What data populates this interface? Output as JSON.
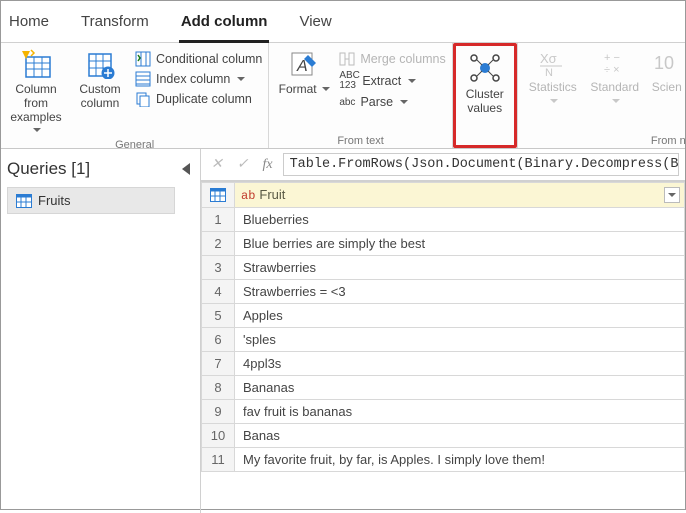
{
  "tabs": {
    "home": "Home",
    "transform": "Transform",
    "add_column": "Add column",
    "view": "View"
  },
  "ribbon": {
    "general": {
      "column_from_examples_l1": "Column from",
      "column_from_examples_l2": "examples",
      "custom_column_l1": "Custom",
      "custom_column_l2": "column",
      "conditional": "Conditional column",
      "index": "Index column",
      "duplicate": "Duplicate column",
      "group_label": "General"
    },
    "from_text": {
      "format": "Format",
      "merge": "Merge columns",
      "extract": "Extract",
      "parse": "Parse",
      "group_label": "From text"
    },
    "cluster_l1": "Cluster",
    "cluster_l2": "values",
    "stats": "Statistics",
    "standard": "Standard",
    "scientific": "Scien",
    "from_number_label": "From n"
  },
  "sidebar": {
    "title": "Queries [1]",
    "item": "Fruits"
  },
  "formula": {
    "text": "Table.FromRows(Json.Document(Binary.Decompress(B"
  },
  "grid": {
    "column_header": "Fruit",
    "rows": [
      "Blueberries",
      "Blue berries are simply the best",
      "Strawberries",
      "Strawberries = <3",
      "Apples",
      "'sples",
      "4ppl3s",
      "Bananas",
      "fav fruit is bananas",
      "Banas",
      "My favorite fruit, by far, is Apples. I simply love them!"
    ]
  }
}
